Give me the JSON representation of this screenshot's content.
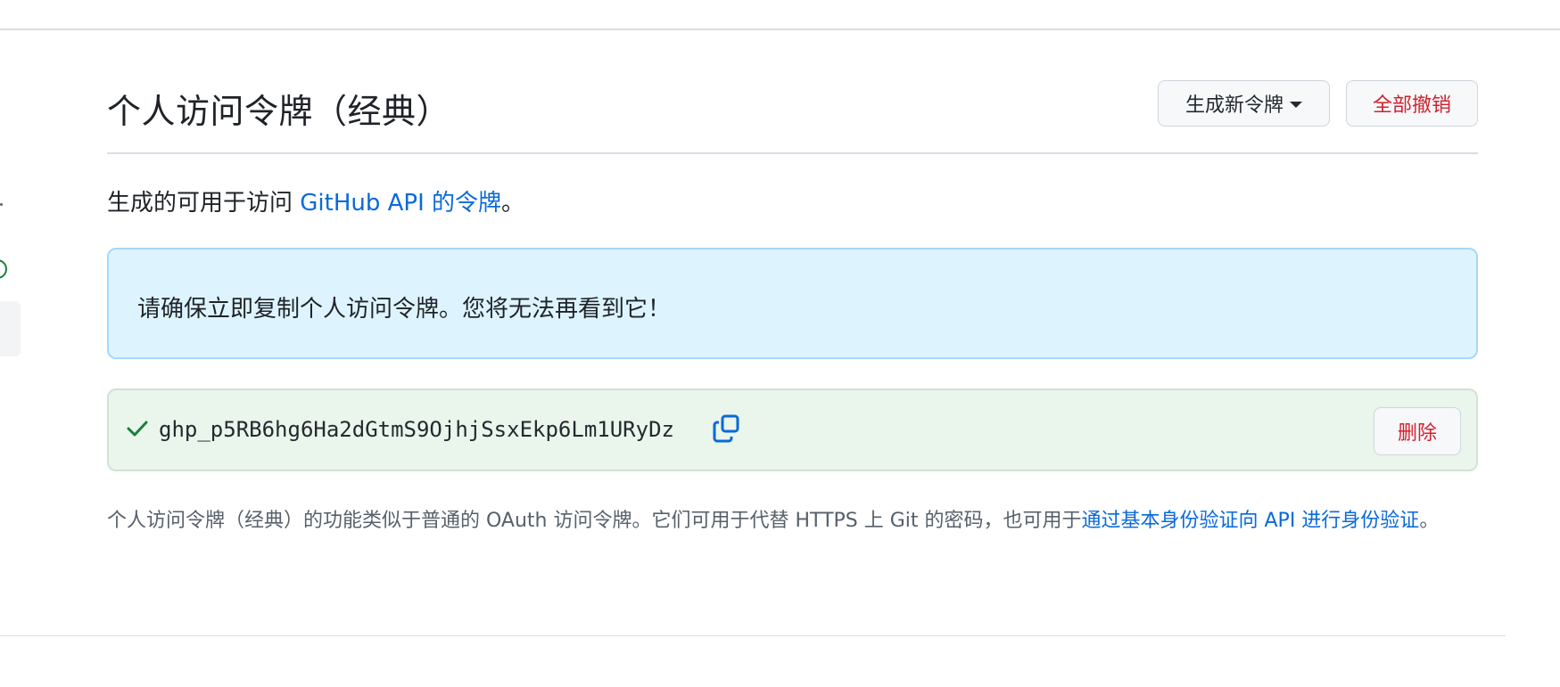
{
  "header": {
    "title": "个人访问令牌（经典）",
    "generate_button_label": "生成新令牌",
    "revoke_all_button_label": "全部撤销"
  },
  "intro": {
    "text_before_link": "生成的可用于访问 ",
    "link_text": "GitHub API 的令牌",
    "text_after_link": "。"
  },
  "flash_info": {
    "message": "请确保立即复制个人访问令牌。您将无法再看到它！"
  },
  "token": {
    "value": "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",
    "delete_label": "删除",
    "check_icon": "check-icon",
    "copy_icon": "copy-icon"
  },
  "footnote": {
    "text": "个人访问令牌（经典）的功能类似于普通的 OAuth 访问令牌。它们可用于代替 HTTPS 上 Git 的密码，也可用于",
    "link_text": "通过基本身份验证向 API 进行身份验证",
    "text_after_link": "。"
  },
  "colors": {
    "accent_link": "#0969da",
    "danger": "#cf222e",
    "info_bg": "#ddf4ff",
    "success_bg": "#eaf5ec",
    "success_icon": "#1a7f37"
  }
}
